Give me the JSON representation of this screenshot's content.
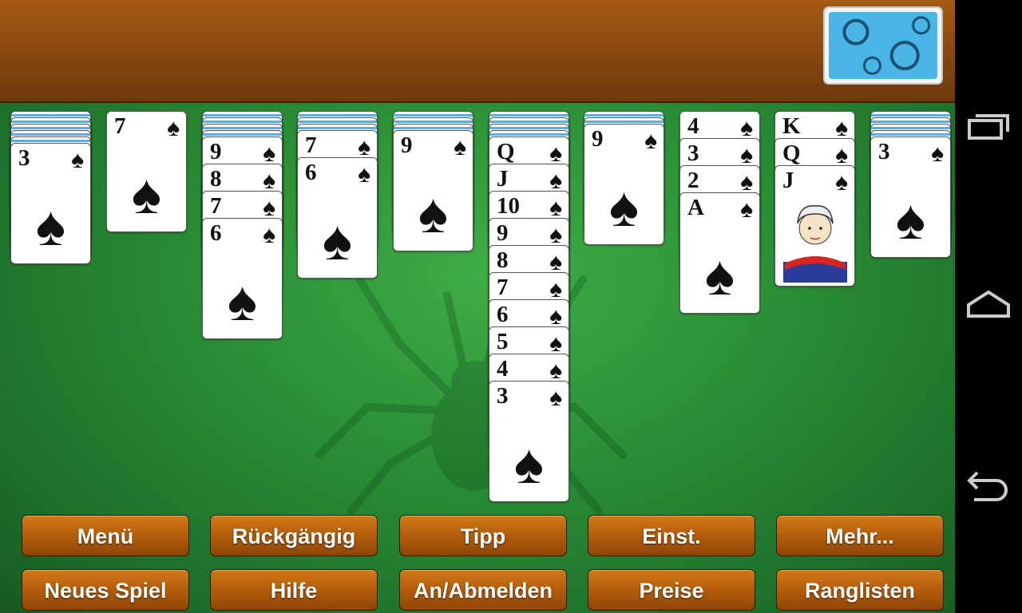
{
  "buttons_row1": [
    "Menü",
    "Rückgängig",
    "Tipp",
    "Einst.",
    "Mehr..."
  ],
  "buttons_row2": [
    "Neues Spiel",
    "Hilfe",
    "An/Abmelden",
    "Preise",
    "Ranglisten"
  ],
  "suit_symbol": "♠",
  "tableau": [
    {
      "facedown": 5,
      "faceup": [
        "3"
      ]
    },
    {
      "facedown": 0,
      "faceup": [
        "7"
      ]
    },
    {
      "facedown": 4,
      "faceup": [
        "9",
        "8",
        "7",
        "6"
      ]
    },
    {
      "facedown": 3,
      "faceup": [
        "7",
        "6"
      ]
    },
    {
      "facedown": 3,
      "faceup": [
        "9"
      ]
    },
    {
      "facedown": 4,
      "faceup": [
        "Q",
        "J",
        "10",
        "9",
        "8",
        "7",
        "6",
        "5",
        "4",
        "3"
      ]
    },
    {
      "facedown": 2,
      "faceup": [
        "9"
      ]
    },
    {
      "facedown": 0,
      "faceup": [
        "4",
        "3",
        "2",
        "A"
      ]
    },
    {
      "facedown": 0,
      "faceup": [
        "K",
        "Q",
        "J"
      ]
    },
    {
      "facedown": 4,
      "faceup": [
        "3"
      ]
    }
  ],
  "colors": {
    "felt": "#2a8f36",
    "wood": "#8c4a10",
    "button": "#b85f0c",
    "card_back": "#49b6e6"
  },
  "icons": {
    "stock": "card-back-pattern",
    "background": "spider-watermark",
    "nav": [
      "recent-apps-icon",
      "home-icon",
      "back-icon"
    ]
  }
}
